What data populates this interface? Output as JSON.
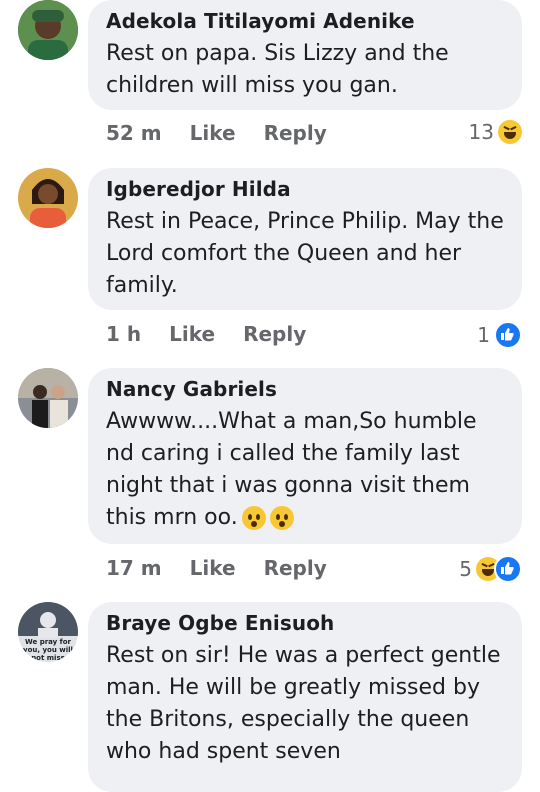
{
  "comments": [
    {
      "name": "Adekola Titilayomi Adenike",
      "text": "Rest on papa. Sis Lizzy and the children will miss you gan.",
      "time": "52 m",
      "like": "Like",
      "reply": "Reply",
      "reaction_count": "13",
      "reactions": [
        "haha-icon"
      ],
      "avatar_color": "#3f7f5a"
    },
    {
      "name": "Igberedjor Hilda",
      "text": "Rest in Peace, Prince Philip. May the Lord comfort the Queen and her family.",
      "time": "1 h",
      "like": "Like",
      "reply": "Reply",
      "reaction_count": "1",
      "reactions": [
        "like-icon"
      ],
      "avatar_color": "#c89a3a"
    },
    {
      "name": "Nancy Gabriels",
      "text": "Awwww....What a man,So humble nd caring i called the family last night that i was gonna visit them this mrn oo.",
      "time": "17 m",
      "like": "Like",
      "reply": "Reply",
      "reaction_count": "5",
      "reactions": [
        "haha-icon",
        "like-icon"
      ],
      "avatar_color": "#6b6b6b"
    },
    {
      "name": "Braye Ogbe Enisuoh",
      "text": "Rest on sir! He was a perfect gentle man. He will be greatly missed by the Britons, especially the queen who had spent seven",
      "avatar_caption": "We pray for you, you will not miss",
      "avatar_color": "#2f3a52"
    }
  ],
  "colors": {
    "bubble": "#eef0f3",
    "meta": "#65676b",
    "like_blue": "#1877f2",
    "haha_yellow": "#f7c834"
  }
}
